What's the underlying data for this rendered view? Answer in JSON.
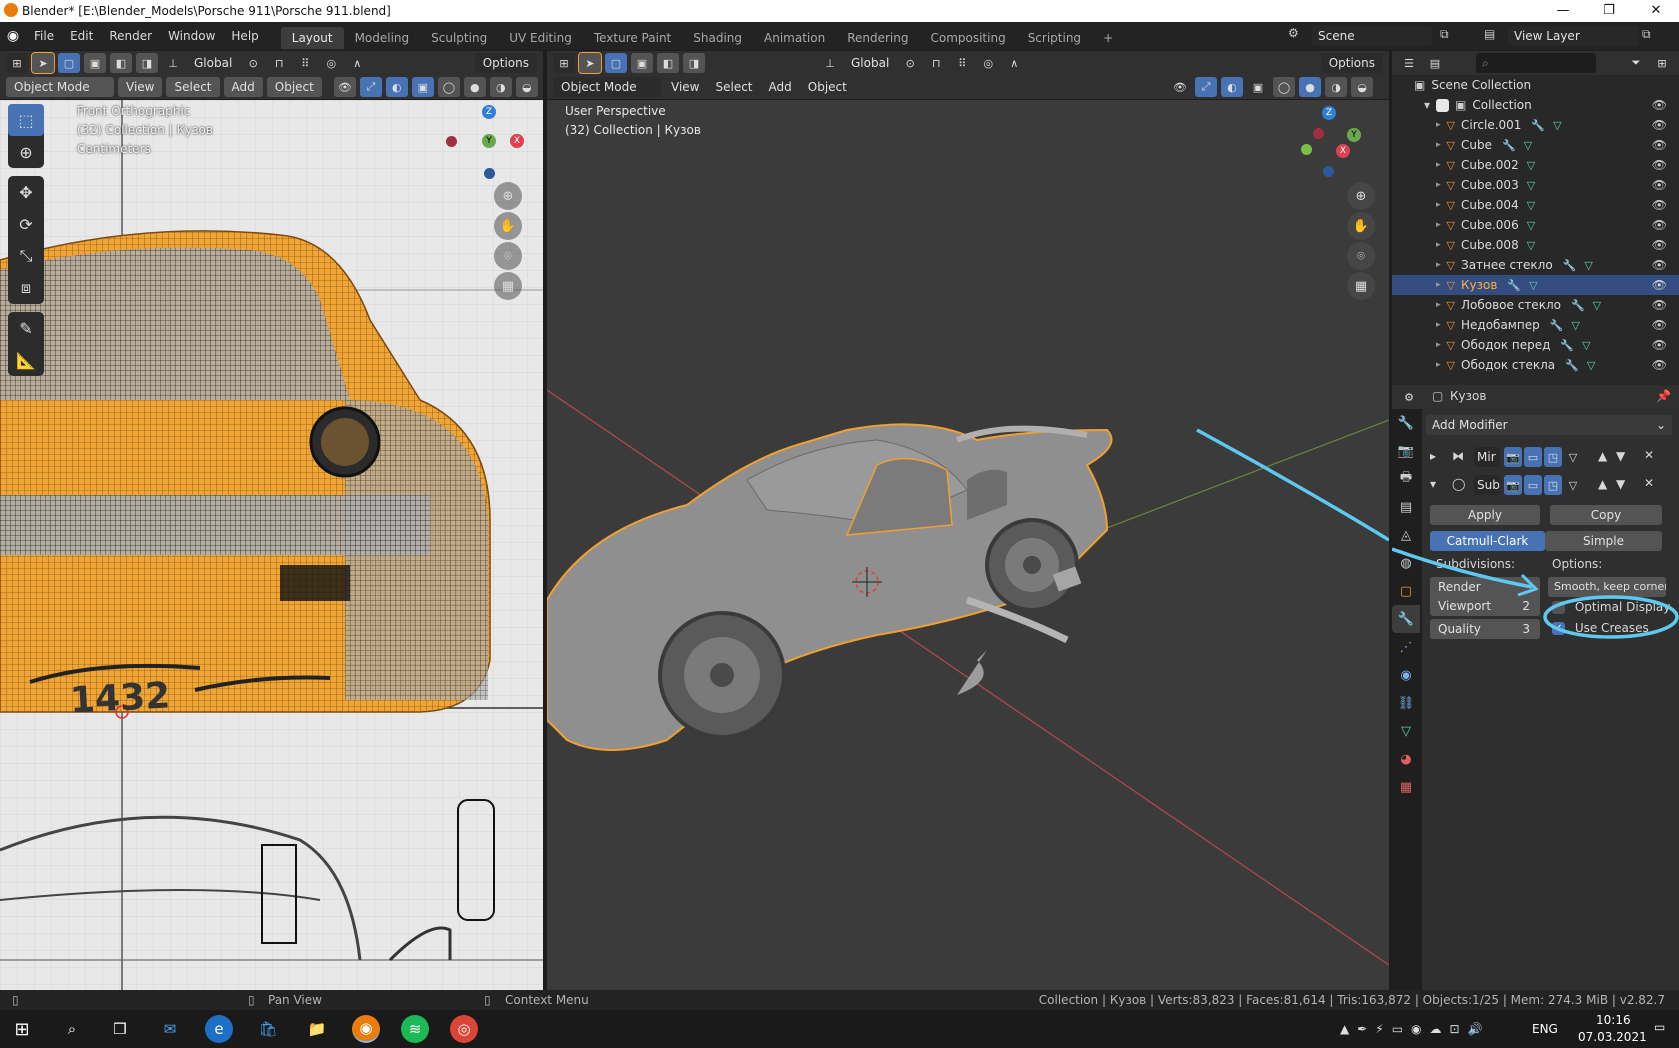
{
  "window": {
    "title": "Blender* [E:\\Blender_Models\\Porsche 911\\Porsche 911.blend]"
  },
  "menu": [
    "File",
    "Edit",
    "Render",
    "Window",
    "Help"
  ],
  "workspaces": [
    "Layout",
    "Modeling",
    "Sculpting",
    "UV Editing",
    "Texture Paint",
    "Shading",
    "Animation",
    "Rendering",
    "Compositing",
    "Scripting"
  ],
  "scene": {
    "label": "Scene",
    "view_layer": "View Layer"
  },
  "left_viewport": {
    "orientation": "Global",
    "options": "Options",
    "mode": "Object Mode",
    "header_menus": [
      "View",
      "Select",
      "Add",
      "Object"
    ],
    "info_line1": "Front Orthographic",
    "info_line2": "(32) Collection | Кузов",
    "info_line3": "Centimeters",
    "drawing_text": "1432"
  },
  "right_viewport": {
    "orientation": "Global",
    "options": "Options",
    "mode": "Object Mode",
    "header_menus": [
      "View",
      "Select",
      "Add",
      "Object"
    ],
    "info_line1": "User Perspective",
    "info_line2": "(32) Collection | Кузов"
  },
  "outliner": {
    "root": "Scene Collection",
    "collection": "Collection",
    "items": [
      {
        "name": "Circle.001",
        "selected": false,
        "modifier": true
      },
      {
        "name": "Cube",
        "selected": false,
        "modifier": true
      },
      {
        "name": "Cube.002",
        "selected": false,
        "modifier": false
      },
      {
        "name": "Cube.003",
        "selected": false,
        "modifier": false
      },
      {
        "name": "Cube.004",
        "selected": false,
        "modifier": false
      },
      {
        "name": "Cube.006",
        "selected": false,
        "modifier": false
      },
      {
        "name": "Cube.008",
        "selected": false,
        "modifier": false
      },
      {
        "name": "Затнее стекло",
        "selected": false,
        "modifier": true
      },
      {
        "name": "Кузов",
        "selected": true,
        "modifier": true
      },
      {
        "name": "Лобовое стекло",
        "selected": false,
        "modifier": true
      },
      {
        "name": "Недобампер",
        "selected": false,
        "modifier": true
      },
      {
        "name": "Ободок перед",
        "selected": false,
        "modifier": true
      },
      {
        "name": "Ободок стекла",
        "selected": false,
        "modifier": true
      }
    ]
  },
  "properties": {
    "object_name": "Кузов",
    "add_modifier": "Add Modifier",
    "modifiers": [
      {
        "name": "Mir",
        "expanded": false
      },
      {
        "name": "Sub",
        "expanded": true
      }
    ],
    "apply": "Apply",
    "copy": "Copy",
    "catmull": "Catmull-Clark",
    "simple": "Simple",
    "subdivisions_label": "Subdivisions:",
    "options_label": "Options:",
    "render_label": "Render",
    "viewport_label": "Viewport",
    "viewport_value": "2",
    "quality_label": "Quality",
    "quality_value": "3",
    "smooth_dropdown": "Smooth, keep corners",
    "optimal_display": "Optimal Display",
    "optimal_checked": false,
    "use_creases": "Use Creases",
    "use_creases_checked": true
  },
  "statusbar": {
    "pan": "Pan View",
    "context": "Context Menu",
    "stats": "Collection | Кузов | Verts:83,823 | Faces:81,614 | Tris:163,872 | Objects:1/25 | Mem: 274.3 MiB | v2.82.7"
  },
  "taskbar": {
    "lang": "ENG",
    "time": "10:16",
    "date": "07.03.2021"
  },
  "colors": {
    "accent": "#4772b3",
    "selection_orange": "#f0a030",
    "annotation": "#5ec8f0"
  }
}
